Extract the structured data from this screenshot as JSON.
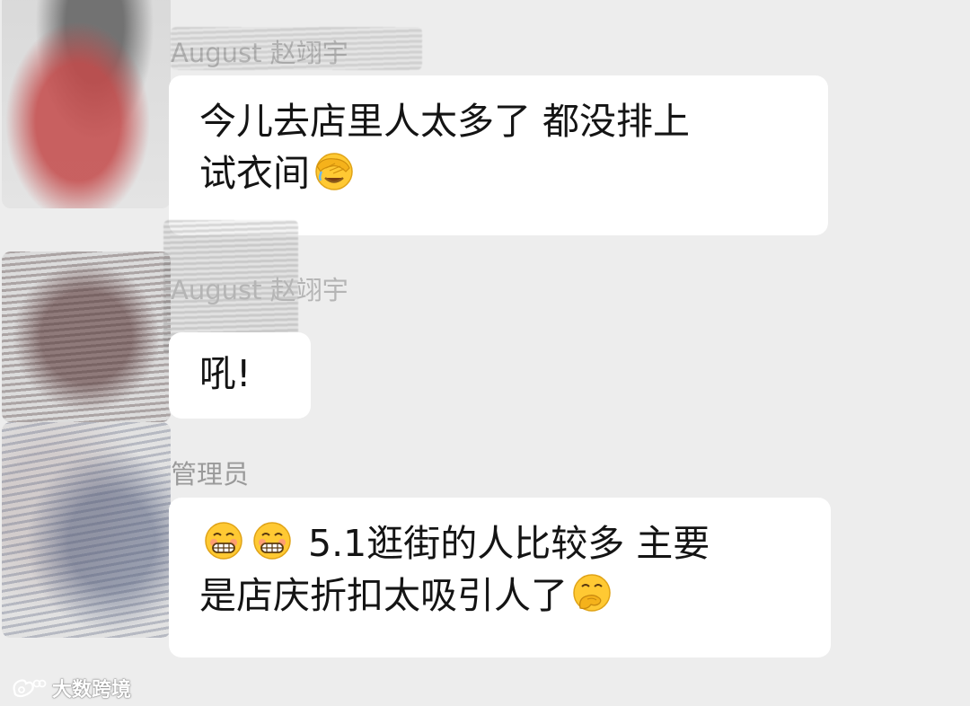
{
  "messages": [
    {
      "sender": "August 赵翊宇",
      "lines": [
        "今儿去店里人太多了 都没排上",
        "试衣间"
      ],
      "emoji": [
        "facepalm-icon"
      ]
    },
    {
      "sender": "August 赵翊宇",
      "lines": [
        "吼!"
      ]
    },
    {
      "sender": "管理员",
      "lines": [
        "5.1逛街的人比较多 主要",
        "是店庆折扣太吸引人了"
      ],
      "emoji": [
        "grinning-face-icon",
        "grinning-face-icon",
        "hand-over-mouth-icon"
      ]
    }
  ],
  "watermark": {
    "text": "大数跨境",
    "icon": "weibo-logo-icon"
  },
  "colors": {
    "background": "#ededed",
    "bubble": "#ffffff",
    "text": "#141414",
    "sender": "#9a9a9a",
    "emoji_yellow": "#ffc933"
  }
}
